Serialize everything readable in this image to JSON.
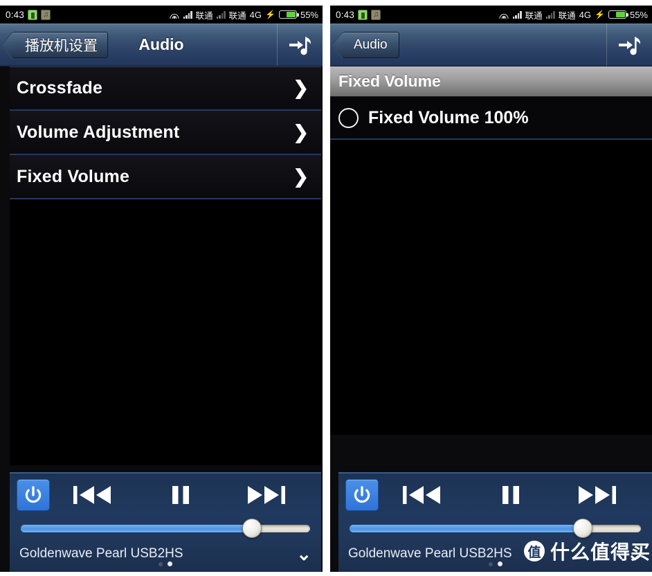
{
  "status_bar": {
    "time": "0:43",
    "app_icons": [
      "battery-app-icon",
      "music-app-icon"
    ],
    "wifi_icon": "wifi-icon",
    "carrier_1": "联通",
    "carrier_2": "联通",
    "network": "4G",
    "charging_icon": "bolt-icon",
    "battery_percent": "55%"
  },
  "left_panel": {
    "nav": {
      "back_label": "播放机设置",
      "title": "Audio",
      "right_icon": "go-to-now-playing-icon"
    },
    "rows": [
      {
        "label": "Crossfade",
        "chevron": "❯"
      },
      {
        "label": "Volume Adjustment",
        "chevron": "❯"
      },
      {
        "label": "Fixed Volume",
        "chevron": "❯"
      }
    ]
  },
  "right_panel": {
    "nav": {
      "back_label": "Audio",
      "title": "",
      "right_icon": "go-to-now-playing-icon"
    },
    "section_header": "Fixed Volume",
    "options": [
      {
        "label": "Fixed Volume 100%",
        "selected": false
      }
    ]
  },
  "player": {
    "power_icon": "power-icon",
    "previous_icon": "previous-track-icon",
    "pause_icon": "pause-icon",
    "next_icon": "next-track-icon",
    "volume_percent": 80,
    "device_name": "Goldenwave Pearl USB2HS",
    "collapse_icon": "chevron-down-icon",
    "page_dots": 2,
    "active_dot": 2
  },
  "watermark": {
    "logo_char": "值",
    "text": "什么值得买"
  },
  "colors": {
    "nav_blue": "#2c4267",
    "accent_blue": "#2f74d8",
    "separator_blue": "#233a5c",
    "battery_green": "#5fd33a",
    "list_bg": "#0a0a0c",
    "header_gray": "#9d9d9d"
  }
}
